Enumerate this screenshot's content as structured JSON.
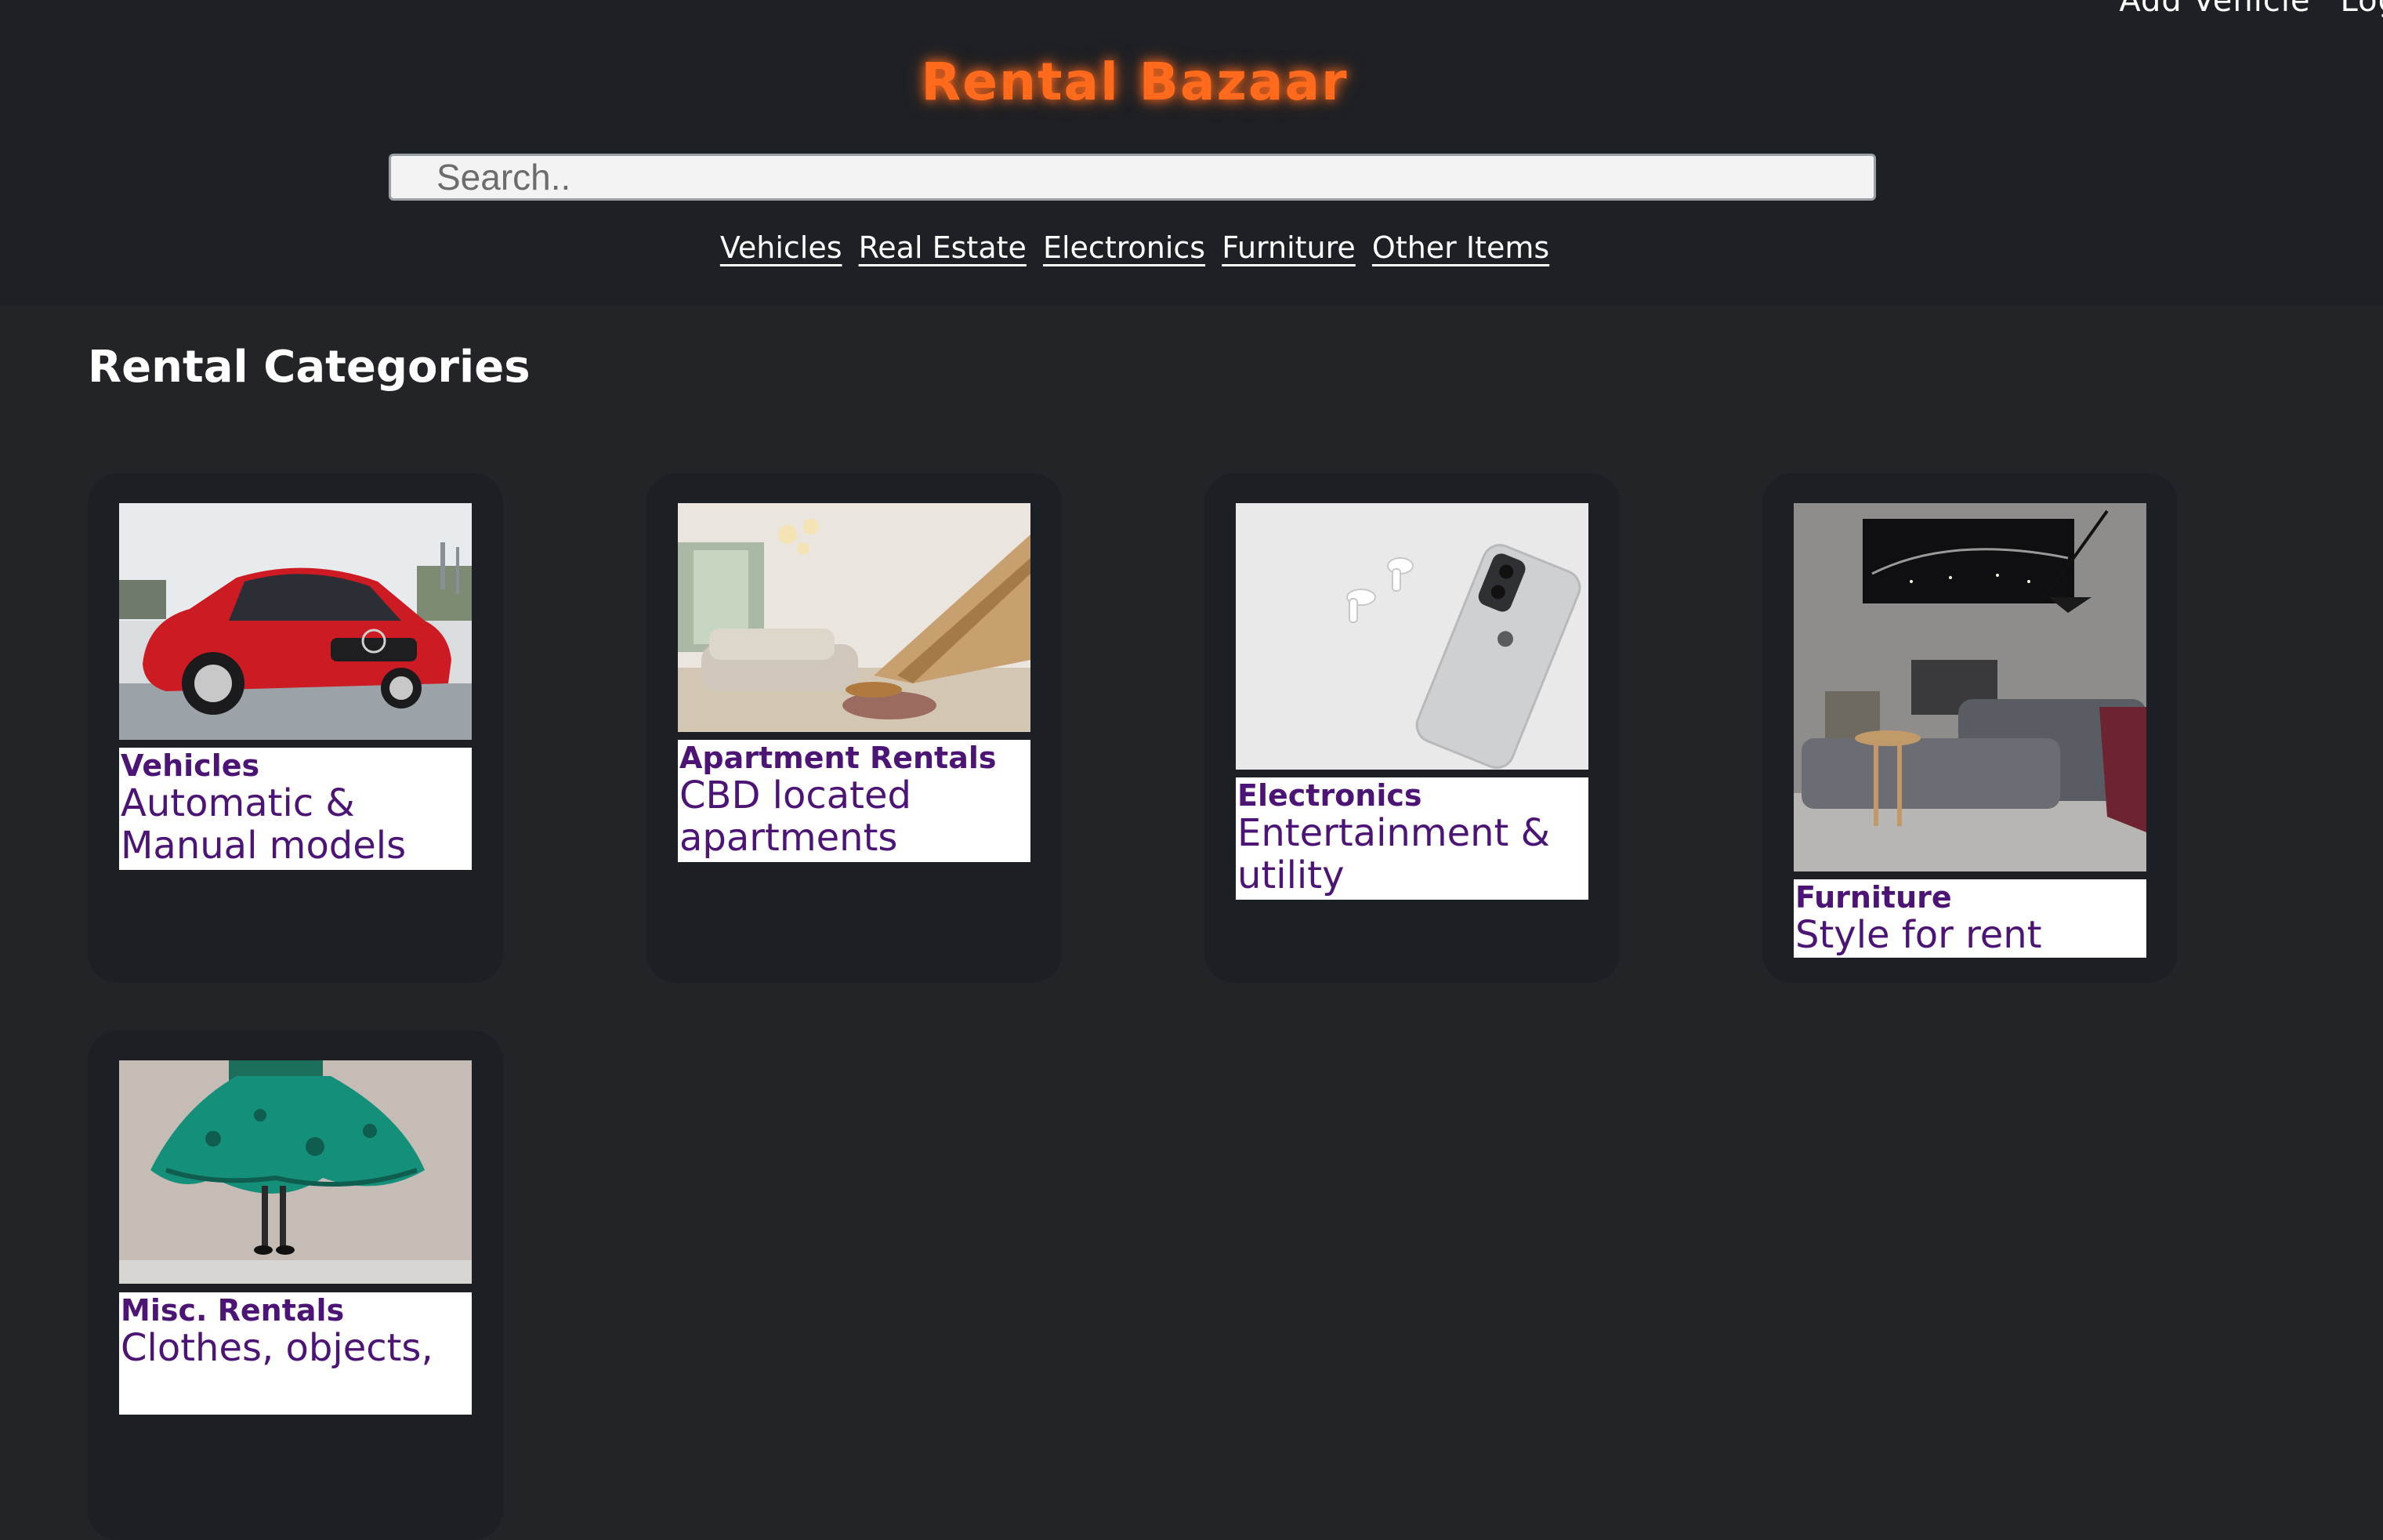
{
  "top_nav": {
    "add_vehicle": "Add Vehicle",
    "login": "Log"
  },
  "brand": "Rental Bazaar",
  "search": {
    "placeholder": "Search..",
    "value": ""
  },
  "category_nav": [
    "Vehicles",
    "Real Estate",
    "Electronics",
    "Furniture",
    "Other Items"
  ],
  "section_title": "Rental Categories",
  "cards": [
    {
      "name": "Vehicles",
      "description": "Automatic & Manual models",
      "image": "red-car-photo"
    },
    {
      "name": "Apartment Rentals",
      "description": "CBD located apartments",
      "image": "living-room-photo"
    },
    {
      "name": "Electronics",
      "description": "Entertainment & utility",
      "image": "phone-earbuds-photo"
    },
    {
      "name": "Furniture",
      "description": "Style for rent",
      "image": "furnished-room-photo"
    },
    {
      "name": "Misc. Rentals",
      "description": "Clothes, objects,",
      "image": "green-dress-photo"
    }
  ]
}
